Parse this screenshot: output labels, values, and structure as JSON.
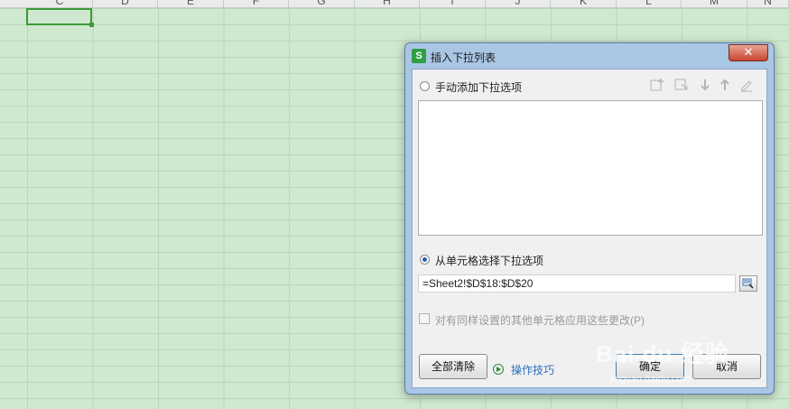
{
  "sheet": {
    "columns": [
      "C",
      "D",
      "E",
      "F",
      "G",
      "H",
      "I",
      "J",
      "K",
      "L",
      "M",
      "N"
    ]
  },
  "dialog": {
    "app_icon": "S",
    "title": "插入下拉列表",
    "close_label": "✕",
    "manual_option_label": "手动添加下拉选项",
    "toolbar_icons": [
      "add-item-icon",
      "select-item-icon",
      "move-down-icon",
      "move-up-icon",
      "edit-icon"
    ],
    "cell_option_label": "从单元格选择下拉选项",
    "range_value": "=Sheet2!$D$18:$D$20",
    "apply_all_label": "对有同样设置的其他单元格应用这些更改(P)",
    "clear_all_button": "全部清除",
    "tips_link": "操作技巧",
    "ok_button": "确定",
    "cancel_button": "取消"
  },
  "watermark": {
    "brand": "Bai du 经验",
    "url": "jingyan.baidu.com"
  }
}
